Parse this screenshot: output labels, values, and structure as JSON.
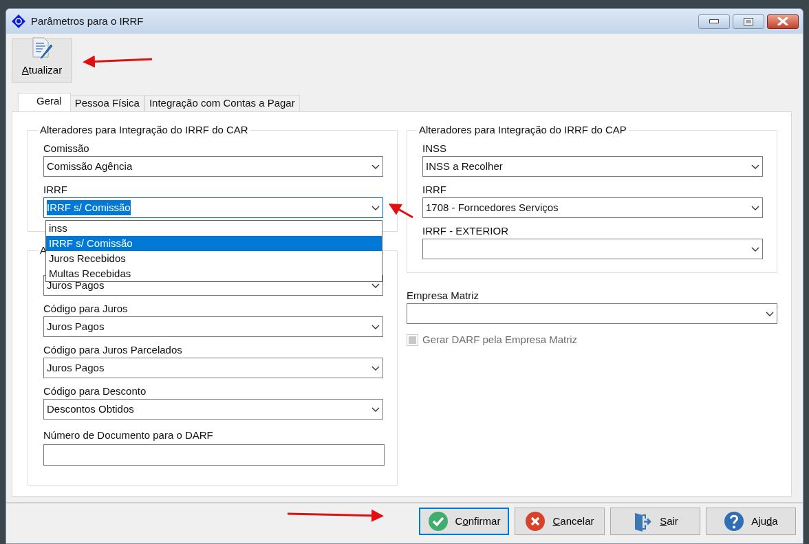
{
  "window": {
    "title": "Parâmetros para o IRRF"
  },
  "toolbar": [
    {
      "mnemonic": "A",
      "label_after": "tualizar",
      "kind": "edit"
    }
  ],
  "tabs": [
    {
      "label": "Geral",
      "selected": true
    },
    {
      "label": "Pessoa Física",
      "selected": false
    },
    {
      "label": "Integração com Contas a Pagar",
      "selected": false
    }
  ],
  "left_column": {
    "groups": [
      {
        "title": "Alteradores para Integração do IRRF do CAR",
        "fields": [
          {
            "kind": "combo",
            "label": "Comissão",
            "value": "Comissão Agência",
            "focused": false
          },
          {
            "kind": "combo",
            "label": "IRRF",
            "value": "IRRF s/ Comissão",
            "focused": true,
            "open_list": [
              {
                "label": "inss",
                "selected": false
              },
              {
                "label": "IRRF s/ Comissão",
                "selected": true
              },
              {
                "label": "Juros Recebidos",
                "selected": false
              },
              {
                "label": "Multas Recebidas",
                "selected": false
              }
            ]
          }
        ]
      },
      {
        "title": "A",
        "fields": [
          {
            "kind": "combo",
            "value": "Juros Pagos",
            "focused": false
          },
          {
            "kind": "combo",
            "label": "Código para Juros",
            "value": "Juros Pagos",
            "focused": false
          },
          {
            "kind": "combo",
            "label": "Código para Juros Parcelados",
            "value": "Juros Pagos",
            "focused": false
          },
          {
            "kind": "combo",
            "label": "Código para Desconto",
            "value": "Descontos Obtidos",
            "focused": false
          },
          {
            "kind": "text",
            "label": "Número de Documento para o DARF"
          }
        ]
      }
    ]
  },
  "right_column": {
    "groups": [
      {
        "title": "Alteradores para Integração do IRRF do CAP",
        "fields": [
          {
            "kind": "combo",
            "label": "INSS",
            "value": "INSS a Recolher",
            "focused": false
          },
          {
            "kind": "combo",
            "label": "IRRF",
            "value": "1708 - Forncedores Serviços",
            "focused": false
          },
          {
            "kind": "combo",
            "label": "IRRF - EXTERIOR",
            "focused": false
          }
        ]
      }
    ],
    "fields": [
      {
        "kind": "combo",
        "label": "Empresa Matriz",
        "focused": false
      }
    ],
    "checkbox": {
      "label": "Gerar DARF pela Empresa Matriz",
      "checked": true,
      "disabled": true
    }
  },
  "buttons": [
    {
      "label_before": "C",
      "mnemonic": "o",
      "label_after": "nfirmar",
      "kind": "confirm",
      "focused": true
    },
    {
      "mnemonic": "C",
      "label_after": "ancelar",
      "kind": "cancel",
      "focused": false
    },
    {
      "mnemonic": "S",
      "label_after": "air",
      "kind": "exit",
      "focused": false
    },
    {
      "label_before": "Aju",
      "mnemonic": "d",
      "label_after": "a",
      "kind": "help",
      "focused": false
    }
  ]
}
